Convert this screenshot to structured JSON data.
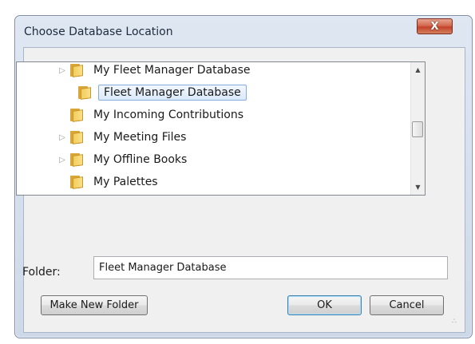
{
  "window": {
    "title": "Choose Database Location",
    "close_symbol": "X"
  },
  "tree": {
    "items": [
      {
        "label": "My Fleet Manager Database",
        "expander": "▷",
        "has_children": true,
        "selected": false
      },
      {
        "label": "Fleet Manager Database",
        "expander": "",
        "has_children": false,
        "selected": true
      },
      {
        "label": "My Incoming Contributions",
        "expander": "",
        "has_children": false,
        "selected": false
      },
      {
        "label": "My Meeting Files",
        "expander": "▷",
        "has_children": true,
        "selected": false
      },
      {
        "label": "My Offline Books",
        "expander": "▷",
        "has_children": true,
        "selected": false
      },
      {
        "label": "My Palettes",
        "expander": "",
        "has_children": false,
        "selected": false
      }
    ],
    "folder_icon": "folder-icon",
    "scroll_up_symbol": "▲",
    "scroll_down_symbol": "▼"
  },
  "folder_field": {
    "label": "Folder:",
    "value": "Fleet Manager Database"
  },
  "buttons": {
    "make_new_folder": "Make New Folder",
    "ok": "OK",
    "cancel": "Cancel"
  }
}
